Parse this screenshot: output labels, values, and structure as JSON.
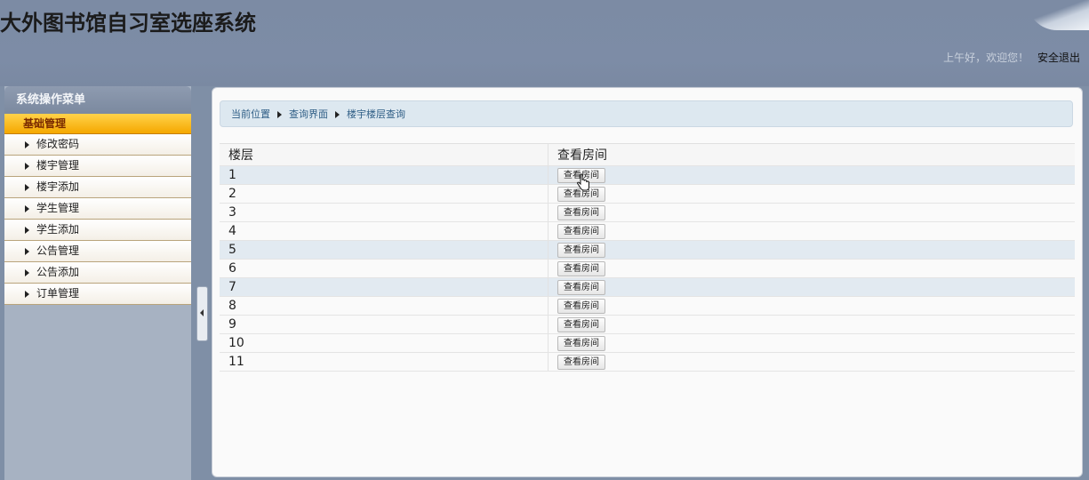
{
  "header": {
    "title": "大外图书馆自习室选座系统",
    "greeting": "上午好，欢迎您！",
    "logout": "安全退出"
  },
  "sidebar": {
    "title": "系统操作菜单",
    "group": "基础管理",
    "items": [
      {
        "label": "修改密码"
      },
      {
        "label": "楼宇管理"
      },
      {
        "label": "楼宇添加"
      },
      {
        "label": "学生管理"
      },
      {
        "label": "学生添加"
      },
      {
        "label": "公告管理"
      },
      {
        "label": "公告添加"
      },
      {
        "label": "订单管理"
      }
    ]
  },
  "breadcrumb": {
    "items": [
      "当前位置",
      "查询界面",
      "楼宇楼层查询"
    ]
  },
  "table": {
    "headers": [
      "楼层",
      "查看房间"
    ],
    "button_label": "查看房间",
    "rows": [
      {
        "floor": "1"
      },
      {
        "floor": "2"
      },
      {
        "floor": "3"
      },
      {
        "floor": "4"
      },
      {
        "floor": "5"
      },
      {
        "floor": "6"
      },
      {
        "floor": "7"
      },
      {
        "floor": "8"
      },
      {
        "floor": "9"
      },
      {
        "floor": "10"
      },
      {
        "floor": "11"
      }
    ]
  },
  "colors": {
    "header_bg": "#7c8ba4",
    "menu_group_bg": "#f5a800",
    "menu_group_text": "#7a2a00",
    "breadcrumb_bg": "#dde8f0",
    "row_highlight": "#e2eaf1"
  }
}
